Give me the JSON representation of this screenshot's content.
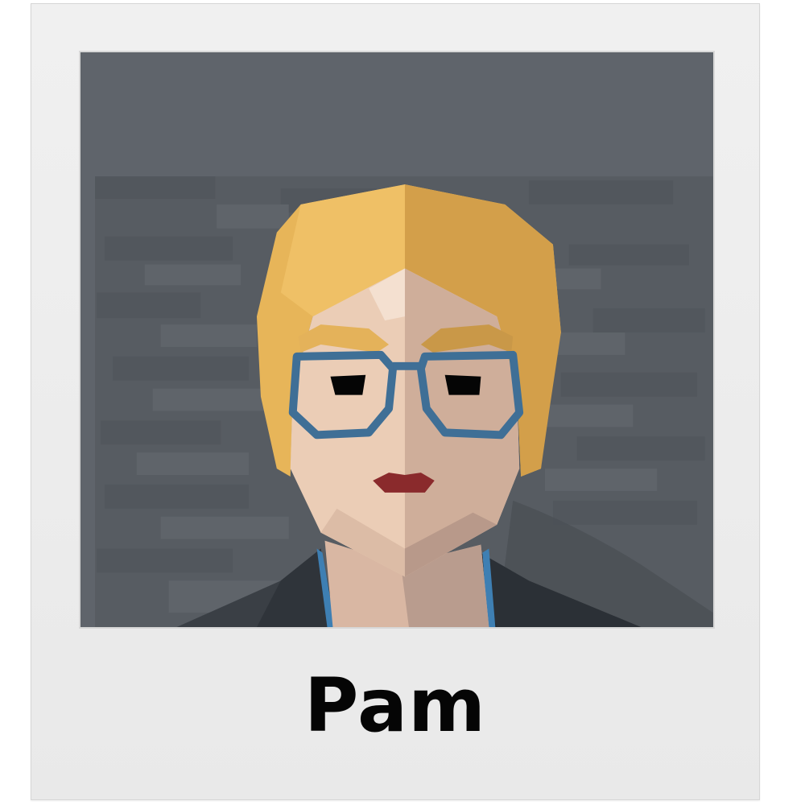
{
  "character": {
    "name": "Pam"
  },
  "colors": {
    "card_background": "#ececec",
    "photo_background": "#5d6269",
    "wall": "#595e64",
    "hair": "#e6b457",
    "skin": "#e7c5ae",
    "glasses": "#3f6f96",
    "lips": "#8a2a2c",
    "jacket": "#2f343a",
    "name_text": "#050505"
  },
  "icons": {
    "portrait": "character-portrait-icon"
  }
}
